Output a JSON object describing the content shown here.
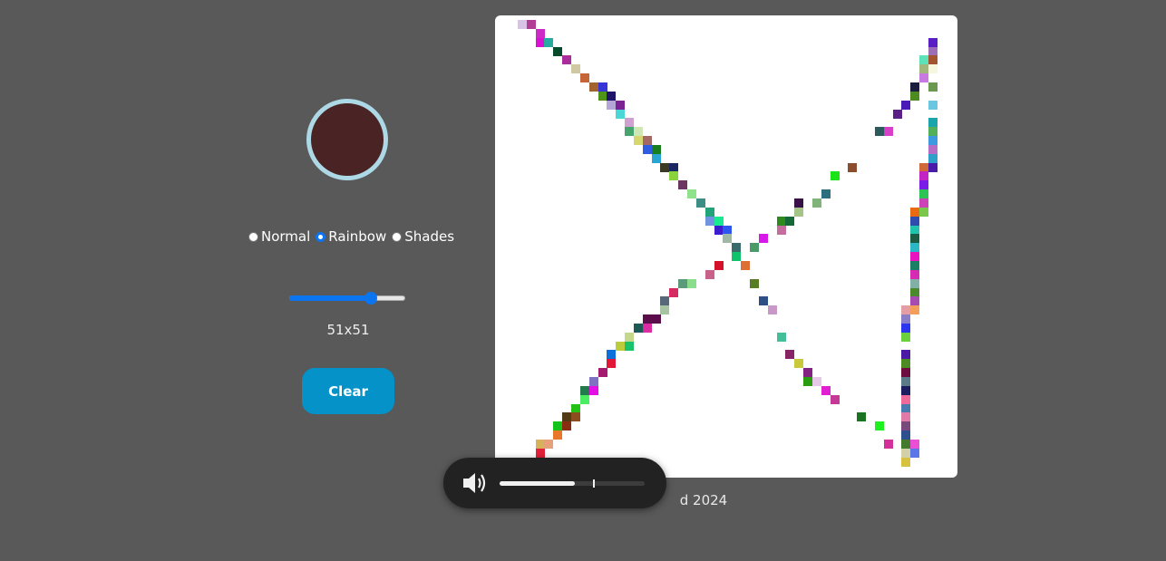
{
  "controls": {
    "current_color": "#4a2424",
    "modes": [
      {
        "label": "Normal",
        "checked": false
      },
      {
        "label": "Rainbow",
        "checked": true
      },
      {
        "label": "Shades",
        "checked": false
      }
    ],
    "grid_size_value": 0.7,
    "size_label": "51x51",
    "clear_label": "Clear"
  },
  "footer_text": "d 2024",
  "volume": {
    "level": 0.52,
    "icon": "speaker-icon"
  },
  "grid": {
    "size": 51,
    "cells": [
      [
        1,
        0,
        "#d8c2e6"
      ],
      [
        2,
        0,
        "#b23d96"
      ],
      [
        3,
        1,
        "#cc2bc5"
      ],
      [
        3,
        2,
        "#d811d2"
      ],
      [
        4,
        2,
        "#26aaa1"
      ],
      [
        5,
        3,
        "#034b2a"
      ],
      [
        6,
        4,
        "#a92d9a"
      ],
      [
        7,
        5,
        "#d0c8a3"
      ],
      [
        8,
        6,
        "#c56538"
      ],
      [
        9,
        7,
        "#a2632e"
      ],
      [
        10,
        7,
        "#3835d6"
      ],
      [
        10,
        8,
        "#4f9318"
      ],
      [
        11,
        8,
        "#1e1468"
      ],
      [
        11,
        9,
        "#b4a6d6"
      ],
      [
        12,
        9,
        "#7a2394"
      ],
      [
        12,
        10,
        "#4ad7d6"
      ],
      [
        13,
        11,
        "#d0a1d0"
      ],
      [
        13,
        12,
        "#46a56f"
      ],
      [
        14,
        12,
        "#cfe6b5"
      ],
      [
        14,
        13,
        "#d6d76f"
      ],
      [
        15,
        13,
        "#a36764"
      ],
      [
        15,
        14,
        "#2e5ce3"
      ],
      [
        16,
        14,
        "#187e1e"
      ],
      [
        16,
        15,
        "#29a6d4"
      ],
      [
        17,
        16,
        "#3a3b22"
      ],
      [
        18,
        16,
        "#1b2862"
      ],
      [
        18,
        17,
        "#8bd33a"
      ],
      [
        19,
        18,
        "#6b3661"
      ],
      [
        20,
        19,
        "#8de28a"
      ],
      [
        21,
        20,
        "#3d8f86"
      ],
      [
        22,
        21,
        "#22a47a"
      ],
      [
        22,
        22,
        "#7292e2"
      ],
      [
        23,
        22,
        "#17ea90"
      ],
      [
        23,
        23,
        "#3d1cd0"
      ],
      [
        24,
        23,
        "#2d55ef"
      ],
      [
        24,
        24,
        "#a0b9a7"
      ],
      [
        25,
        25,
        "#386b69"
      ],
      [
        25,
        26,
        "#10c36a"
      ],
      [
        26,
        27,
        "#dd6f36"
      ],
      [
        27,
        29,
        "#597d25"
      ],
      [
        28,
        31,
        "#2d4f85"
      ],
      [
        29,
        32,
        "#c899c8"
      ],
      [
        30,
        35,
        "#42bf98"
      ],
      [
        31,
        37,
        "#862466"
      ],
      [
        32,
        38,
        "#c9c93c"
      ],
      [
        33,
        39,
        "#832283"
      ],
      [
        33,
        40,
        "#2a9c0f"
      ],
      [
        34,
        40,
        "#e6c8e8"
      ],
      [
        35,
        41,
        "#e01ed2"
      ],
      [
        36,
        42,
        "#c43898"
      ],
      [
        39,
        44,
        "#1a7320"
      ],
      [
        41,
        45,
        "#1df11e"
      ],
      [
        42,
        47,
        "#d3309a"
      ],
      [
        44,
        48,
        "#d2d0a8"
      ],
      [
        44,
        49,
        "#d6c23e"
      ],
      [
        47,
        2,
        "#5a1ec5"
      ],
      [
        47,
        3,
        "#9e6eb4"
      ],
      [
        47,
        4,
        "#a3532d"
      ],
      [
        46,
        4,
        "#5de1b8"
      ],
      [
        46,
        5,
        "#a2b87a"
      ],
      [
        47,
        5,
        "#f7f7e0"
      ],
      [
        46,
        6,
        "#c97ae0"
      ],
      [
        47,
        7,
        "#6a9a52"
      ],
      [
        45,
        7,
        "#1b1d3e"
      ],
      [
        45,
        8,
        "#4d8b20"
      ],
      [
        44,
        9,
        "#4a1ab8"
      ],
      [
        47,
        9,
        "#6bc6e2"
      ],
      [
        43,
        10,
        "#5c2187"
      ],
      [
        47,
        11,
        "#1aa4ab"
      ],
      [
        47,
        12,
        "#52b05a"
      ],
      [
        47,
        13,
        "#3d9ae0"
      ],
      [
        47,
        14,
        "#b56dc5"
      ],
      [
        47,
        15,
        "#2d9fc8"
      ],
      [
        47,
        16,
        "#4a1aa8"
      ],
      [
        46,
        16,
        "#cf6a38"
      ],
      [
        46,
        17,
        "#c225c3"
      ],
      [
        46,
        18,
        "#7a1be8"
      ],
      [
        46,
        19,
        "#2ec454"
      ],
      [
        46,
        20,
        "#cc42b7"
      ],
      [
        46,
        21,
        "#79c74b"
      ],
      [
        45,
        21,
        "#ea6a14"
      ],
      [
        45,
        22,
        "#2e4bad"
      ],
      [
        45,
        23,
        "#21c3ad"
      ],
      [
        45,
        24,
        "#1d5c44"
      ],
      [
        45,
        25,
        "#2db6c4"
      ],
      [
        45,
        26,
        "#ea14c0"
      ],
      [
        45,
        27,
        "#1b7f66"
      ],
      [
        45,
        28,
        "#d52cb3"
      ],
      [
        45,
        29,
        "#82b0a6"
      ],
      [
        45,
        30,
        "#4b8a2c"
      ],
      [
        45,
        31,
        "#a64cb0"
      ],
      [
        44,
        32,
        "#e49ea4"
      ],
      [
        45,
        32,
        "#f39f5b"
      ],
      [
        44,
        33,
        "#8a7ec8"
      ],
      [
        44,
        34,
        "#2b34ef"
      ],
      [
        44,
        35,
        "#6ad13c"
      ],
      [
        44,
        37,
        "#4a1aa4"
      ],
      [
        44,
        38,
        "#4c8b23"
      ],
      [
        44,
        39,
        "#6d0c3e"
      ],
      [
        44,
        40,
        "#5b7b88"
      ],
      [
        44,
        41,
        "#1b1d5e"
      ],
      [
        44,
        42,
        "#ee6a9a"
      ],
      [
        44,
        43,
        "#4a7bb0"
      ],
      [
        44,
        44,
        "#e07aa6"
      ],
      [
        44,
        45,
        "#7a497c"
      ],
      [
        44,
        46,
        "#2d4f8e"
      ],
      [
        44,
        47,
        "#447a2e"
      ],
      [
        45,
        47,
        "#eb4fd6"
      ],
      [
        45,
        48,
        "#5b77e7"
      ],
      [
        41,
        12,
        "#2c5a5c"
      ],
      [
        42,
        12,
        "#d73fc8"
      ],
      [
        38,
        16,
        "#8b4d2c"
      ],
      [
        36,
        17,
        "#18e417"
      ],
      [
        35,
        19,
        "#2c6d7e"
      ],
      [
        32,
        20,
        "#3a1048"
      ],
      [
        34,
        20,
        "#82b37a"
      ],
      [
        32,
        21,
        "#a4c488"
      ],
      [
        30,
        22,
        "#2f8a1c"
      ],
      [
        31,
        22,
        "#136a37"
      ],
      [
        30,
        23,
        "#c46d9e"
      ],
      [
        28,
        24,
        "#d619e8"
      ],
      [
        27,
        25,
        "#4a9a6a"
      ],
      [
        23,
        27,
        "#d6112c"
      ],
      [
        22,
        28,
        "#c9628a"
      ],
      [
        19,
        29,
        "#5b9a7a"
      ],
      [
        20,
        29,
        "#89dd8b"
      ],
      [
        18,
        30,
        "#d52b62"
      ],
      [
        17,
        31,
        "#57687a"
      ],
      [
        17,
        32,
        "#a7c4a2"
      ],
      [
        15,
        33,
        "#5b0d4c"
      ],
      [
        16,
        33,
        "#5b0d4c"
      ],
      [
        14,
        34,
        "#1d5a55"
      ],
      [
        15,
        34,
        "#dc2ca1"
      ],
      [
        13,
        35,
        "#c4d78b"
      ],
      [
        12,
        36,
        "#bdcc3a"
      ],
      [
        13,
        36,
        "#1ac36a"
      ],
      [
        11,
        37,
        "#0c70da"
      ],
      [
        11,
        38,
        "#e21737"
      ],
      [
        10,
        39,
        "#a31a6e"
      ],
      [
        9,
        40,
        "#8072c2"
      ],
      [
        8,
        41,
        "#237a4a"
      ],
      [
        9,
        41,
        "#e40fe5"
      ],
      [
        8,
        42,
        "#4bee62"
      ],
      [
        7,
        43,
        "#22c314"
      ],
      [
        6,
        44,
        "#523b14"
      ],
      [
        7,
        44,
        "#8c4d1f"
      ],
      [
        5,
        45,
        "#13c31a"
      ],
      [
        6,
        45,
        "#892d12"
      ],
      [
        5,
        46,
        "#ea762a"
      ],
      [
        3,
        47,
        "#d6b35a"
      ],
      [
        4,
        47,
        "#e6a07a"
      ],
      [
        3,
        48,
        "#e3213a"
      ],
      [
        1,
        49,
        "#c96b9b"
      ],
      [
        2,
        49,
        "#b42a6e"
      ]
    ]
  }
}
